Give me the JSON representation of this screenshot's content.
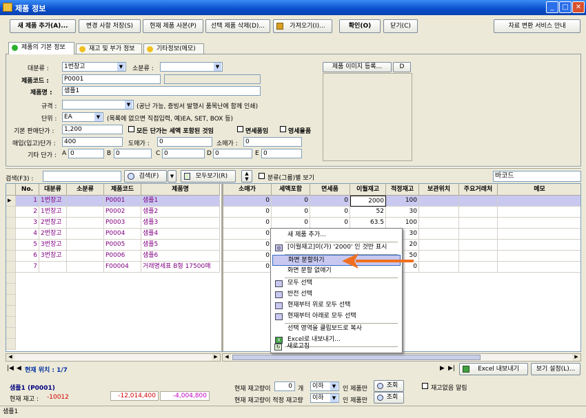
{
  "window": {
    "title": "제품 정보"
  },
  "toolbar": {
    "new_product": "새 제품 추가(A)...",
    "save_changes": "변경 사항 저장(S)",
    "copy_product": "현재 제품 사본(P)",
    "delete_selected": "선택 제품 삭제(D)...",
    "import": "가져오기(I)...",
    "confirm": "확인(O)",
    "close": "닫기(C)",
    "data_convert": "자료 변환 서비스 안내"
  },
  "tabs": [
    "제품의 기본 정보",
    "재고 및 부가 정보",
    "기타정보(메모)"
  ],
  "form": {
    "major_label": "대분류 :",
    "major_value": "1번창고",
    "minor_label": "소분류 :",
    "minor_value": "",
    "code_label": "제품코드 :",
    "code_value": "P0001",
    "name_label": "제품명 :",
    "name_value": "샘플1",
    "spec_label": "규격 :",
    "spec_value": "",
    "spec_note": "(공난 가능, 증빙서 발행시 품목난에 함께 인쇄)",
    "unit_label": "단위 :",
    "unit_value": "EA",
    "unit_note": "(목록에 없으면 직접입력, 예)EA, SET, BOX 등)",
    "base_price_label": "기본 판매단가 :",
    "base_price_value": "1,200",
    "vat_all": "모든 단가는 세액 포함된 것임",
    "tax_free": "면세품임",
    "zero_rate": "영세율품",
    "buy_price_label": "매입(입고)단가 :",
    "buy_price_value": "400",
    "wholesale_label": "도매가 :",
    "wholesale_value": "0",
    "retail_label": "소매가 :",
    "retail_value": "0",
    "other_label": "기타 단가 :",
    "other_a": "A",
    "other_a_val": "0",
    "other_b": "B",
    "other_b_val": "0",
    "other_c": "C",
    "other_c_val": "0",
    "other_d": "D",
    "other_d_val": "0",
    "other_e": "E",
    "other_e_val": "0",
    "image_btn": "제품 이미지 등록...",
    "image_d": "D"
  },
  "search": {
    "label": "검색(F3) :",
    "search_btn": "검색(F)",
    "show_all": "모두보기(R)",
    "group_view": "분류(그룹)별 보기",
    "barcode_label": "바코드"
  },
  "grid": {
    "headers_left": [
      "No.",
      "대분류",
      "소분류",
      "제품코드",
      "제품명"
    ],
    "headers_right": [
      "소매가",
      "세액포함",
      "면세품",
      "이월재고",
      "적정재고",
      "보관위치",
      "주요거래처",
      "메모"
    ],
    "rows": [
      {
        "no": "1",
        "major": "1번창고",
        "minor": "",
        "code": "P0001",
        "name": "샘플1",
        "retail": "0",
        "vat": "0",
        "taxfree": "0",
        "carry": "2000",
        "proper": "100"
      },
      {
        "no": "2",
        "major": "1번창고",
        "minor": "",
        "code": "P0002",
        "name": "샘플2",
        "retail": "0",
        "vat": "0",
        "taxfree": "0",
        "carry": "52",
        "proper": "30"
      },
      {
        "no": "3",
        "major": "2번창고",
        "minor": "",
        "code": "P0003",
        "name": "샘플3",
        "retail": "0",
        "vat": "0",
        "taxfree": "0",
        "carry": "63.5",
        "proper": "100"
      },
      {
        "no": "4",
        "major": "2번창고",
        "minor": "",
        "code": "P0004",
        "name": "샘플4",
        "retail": "0",
        "vat": "",
        "taxfree": "",
        "carry": "",
        "proper": "30"
      },
      {
        "no": "5",
        "major": "3번창고",
        "minor": "",
        "code": "P0005",
        "name": "샘플5",
        "retail": "0",
        "vat": "",
        "taxfree": "",
        "carry": "",
        "proper": "20"
      },
      {
        "no": "6",
        "major": "3번창고",
        "minor": "",
        "code": "P0006",
        "name": "샘플6",
        "retail": "0",
        "vat": "",
        "taxfree": "",
        "carry": "",
        "proper": "50"
      },
      {
        "no": "7",
        "major": "",
        "minor": "",
        "code": "F00004",
        "name": "거래명세표 B형 17500매",
        "retail": "0",
        "vat": "",
        "taxfree": "",
        "carry": "",
        "proper": "0"
      }
    ]
  },
  "context_menu": [
    "새 제품 추가...",
    "[이월재고]이(가) '2000' 인 것만 표시",
    "화면 분할하기",
    "화면 분할 없애기",
    "모두 선택",
    "반전 선택",
    "현재부터 위로 모두 선택",
    "현재부터 아래로 모두 선택",
    "선택 영역을 클립보드로 복사",
    "Excel로 내보내기...",
    "새로고침"
  ],
  "nav": {
    "position": "현재 위치 : 1/7",
    "excel_export": "Excel 내보내기",
    "view_settings": "보기 설정(L)..."
  },
  "footer": {
    "product": "샘플1 (P0001)",
    "stock_label": "현재 재고 :",
    "stock_value": "-10012",
    "amount1": "-12,014,400",
    "amount2": "-4,004,800",
    "stock_if_label": "현재 재고량이",
    "stock_if_value": "0",
    "unit_word": "개",
    "cond1": "이하",
    "only_products": "인 제품만",
    "lookup": "조회",
    "proper_label": "현재 재고량이 적정 재고량",
    "cond2": "이하",
    "no_stock_alert": "재고없음 알림"
  },
  "status": {
    "text": "샘플1"
  },
  "colors": {
    "accent_arrow": "#f07020",
    "selected_row": "#c8c8f0",
    "highlight": "#316ac5"
  }
}
